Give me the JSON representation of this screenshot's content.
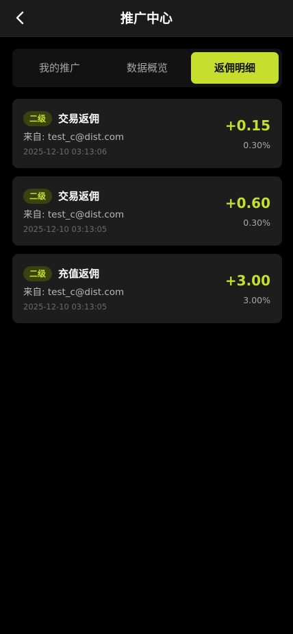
{
  "header": {
    "title": "推广中心",
    "back_icon": "chevron-left-icon"
  },
  "tabs": [
    {
      "label": "我的推广",
      "active": false
    },
    {
      "label": "数据概览",
      "active": false
    },
    {
      "label": "返佣明细",
      "active": true
    }
  ],
  "records": [
    {
      "level": "二级",
      "type": "交易返佣",
      "source": "来自: test_c@dist.com",
      "time": "2025-12-10 03:13:06",
      "amount": "+0.15",
      "rate": "0.30%"
    },
    {
      "level": "二级",
      "type": "交易返佣",
      "source": "来自: test_c@dist.com",
      "time": "2025-12-10 03:13:05",
      "amount": "+0.60",
      "rate": "0.30%"
    },
    {
      "level": "二级",
      "type": "充值返佣",
      "source": "来自: test_c@dist.com",
      "time": "2025-12-10 03:13:05",
      "amount": "+3.00",
      "rate": "3.00%"
    }
  ],
  "colors": {
    "accent": "#c6de2e",
    "background": "#000000",
    "card": "#1d1d1d",
    "header": "#1b1b1b"
  }
}
